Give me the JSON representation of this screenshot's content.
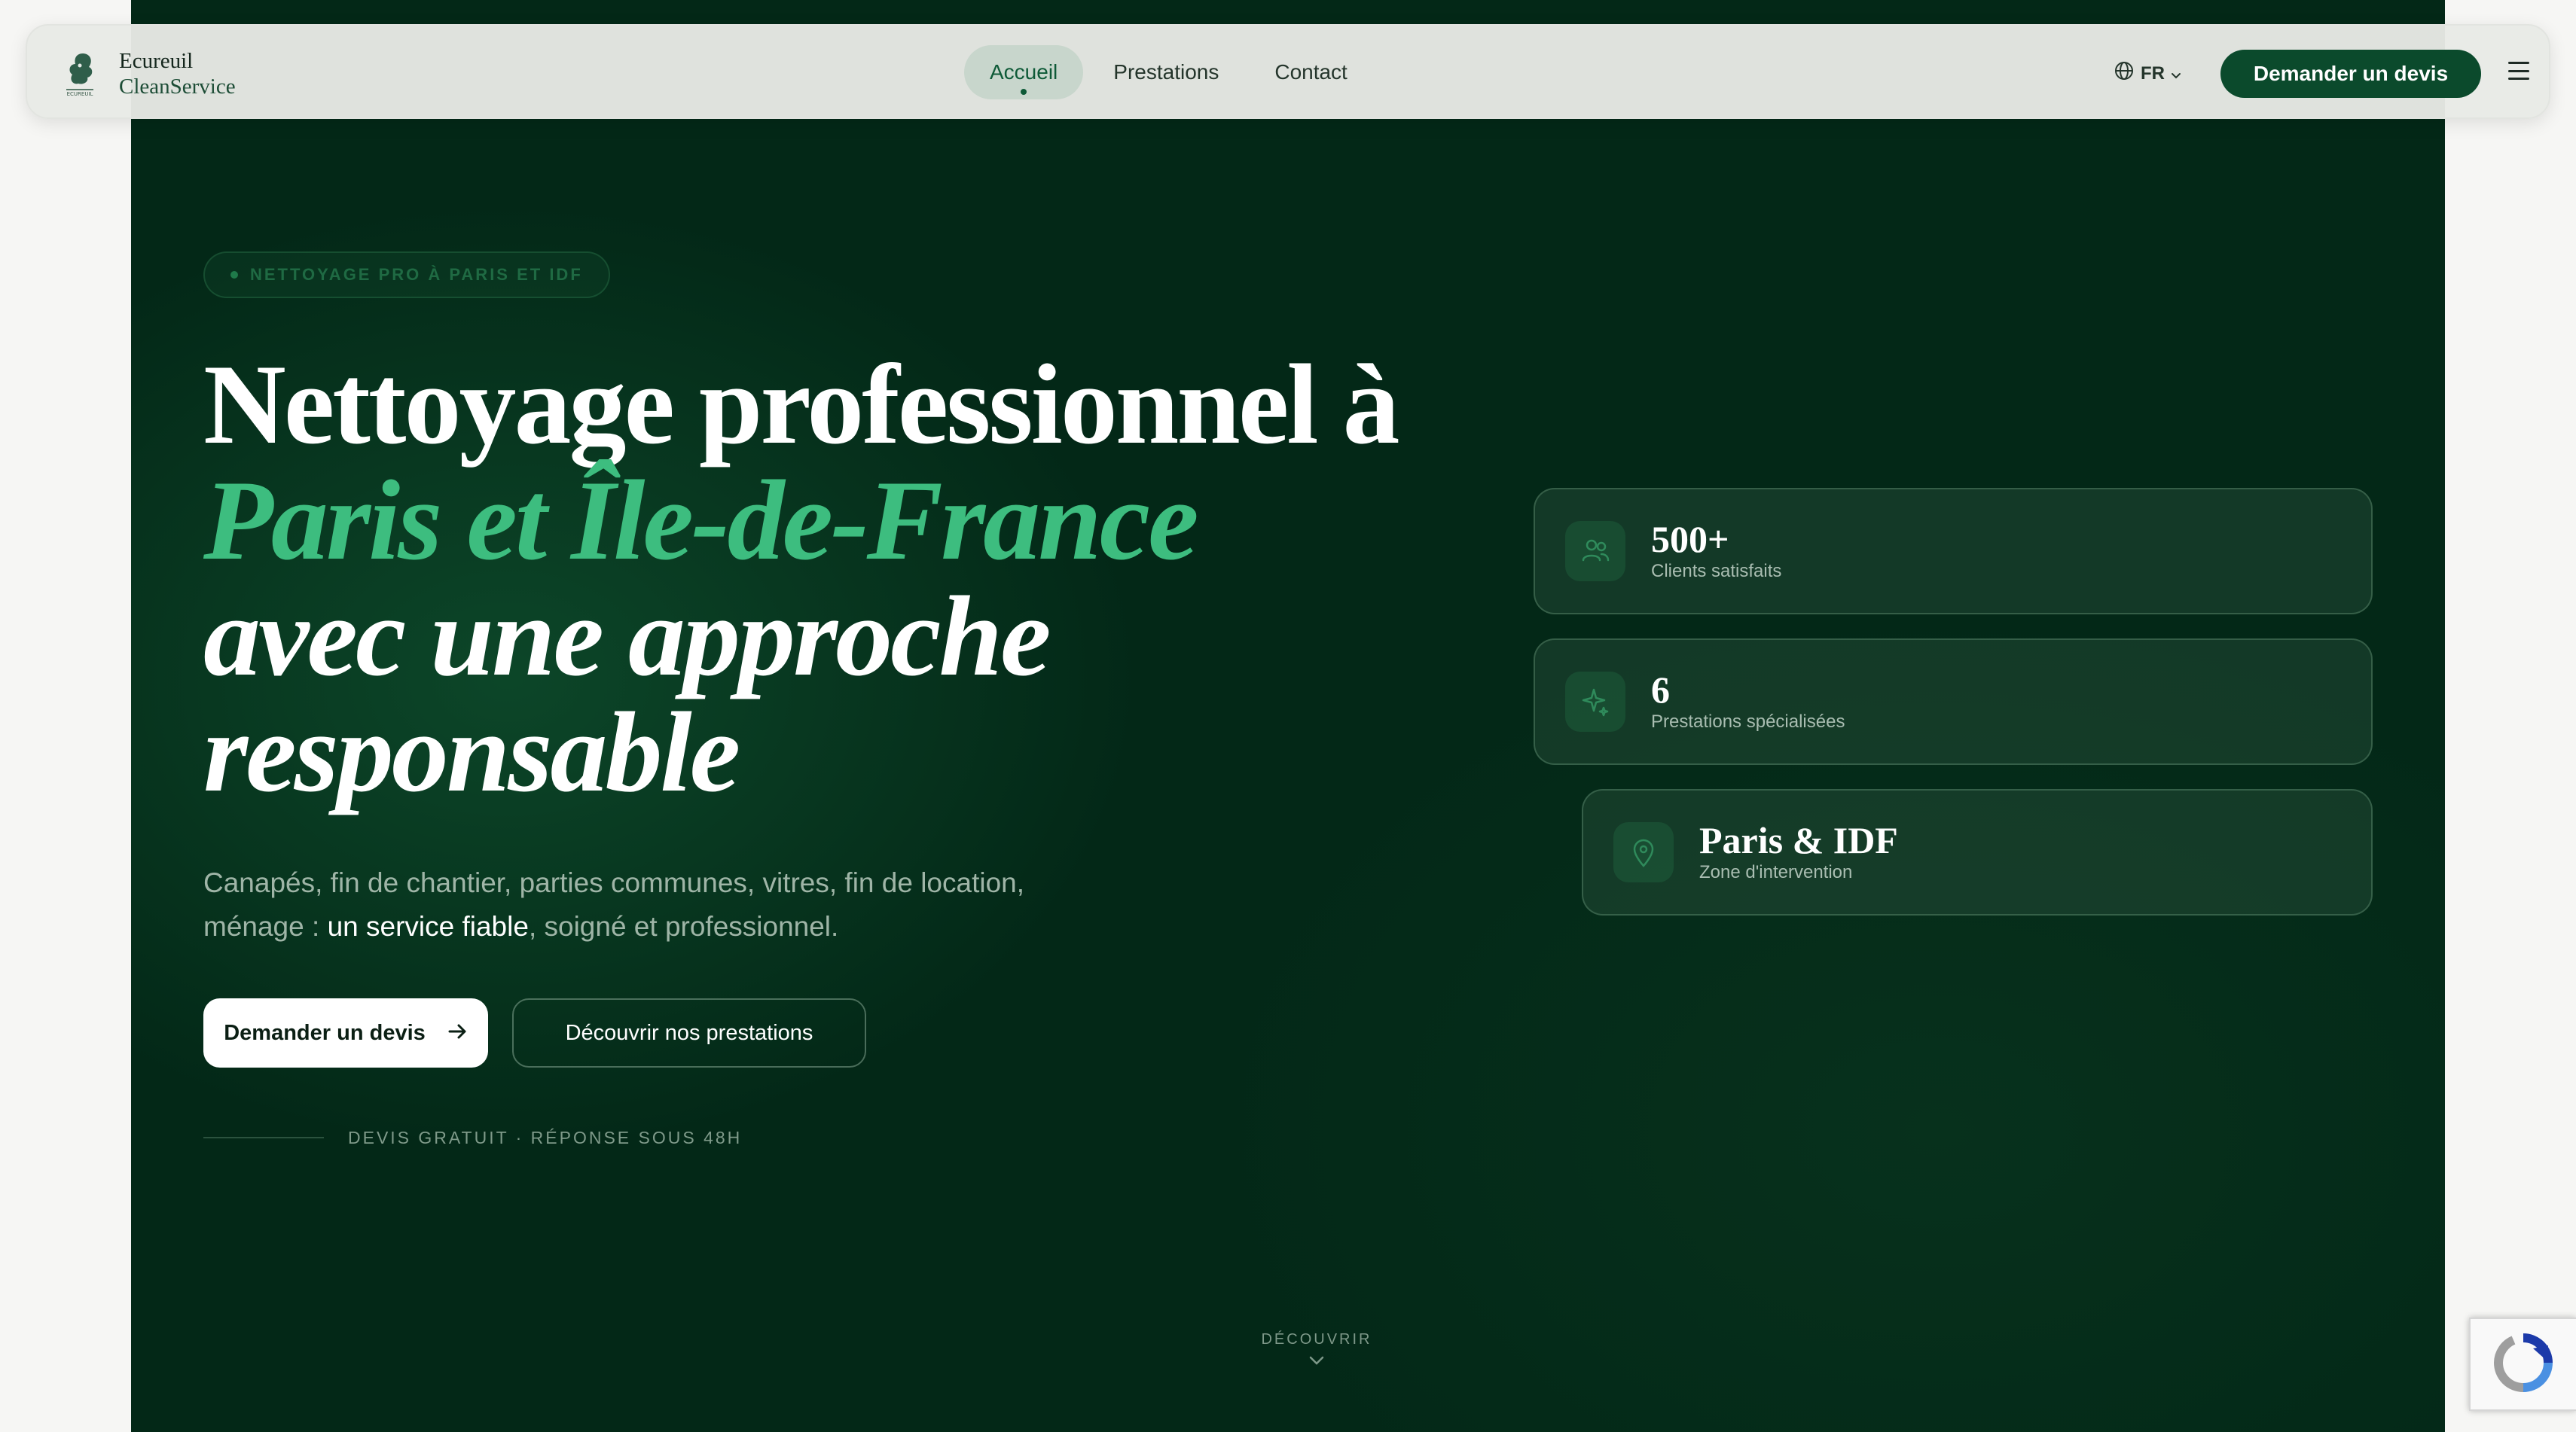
{
  "brand": {
    "logo_icon": "squirrel-logo-icon",
    "name_line1": "Ecureuil",
    "name_line2": "CleanService",
    "logo_caption": "ECUREUIL"
  },
  "nav": {
    "items": [
      {
        "label": "Accueil",
        "active": true
      },
      {
        "label": "Prestations",
        "active": false
      },
      {
        "label": "Contact",
        "active": false
      }
    ],
    "language": "FR",
    "cta_label": "Demander un devis"
  },
  "hero": {
    "badge": "NETTOYAGE PRO À PARIS ET IDF",
    "headline_line1": "Nettoyage professionnel à",
    "headline_line2": "Paris et Île-de-France",
    "headline_line3": "avec une approche",
    "headline_line4": "responsable",
    "subtitle_part1": "Canapés, fin de chantier, parties communes, vitres, fin de location,",
    "subtitle_part2": "ménage : ",
    "subtitle_strong": "un service fiable",
    "subtitle_part3": ", soigné et professionnel.",
    "primary_button": "Demander un devis",
    "secondary_button": "Découvrir nos prestations",
    "note": "DEVIS GRATUIT · RÉPONSE SOUS 48H",
    "scroll_label": "DÉCOUVRIR"
  },
  "stats": [
    {
      "value": "500+",
      "label": "Clients satisfaits",
      "icon": "users-icon"
    },
    {
      "value": "6",
      "label": "Prestations spécialisées",
      "icon": "sparkles-icon"
    },
    {
      "value": "Paris & IDF",
      "label": "Zone d'intervention",
      "icon": "map-pin-icon"
    }
  ],
  "colors": {
    "hero_bg": "#032817",
    "accent_green": "#3dbd7f",
    "cta_dark_green": "#0b4a2c"
  }
}
